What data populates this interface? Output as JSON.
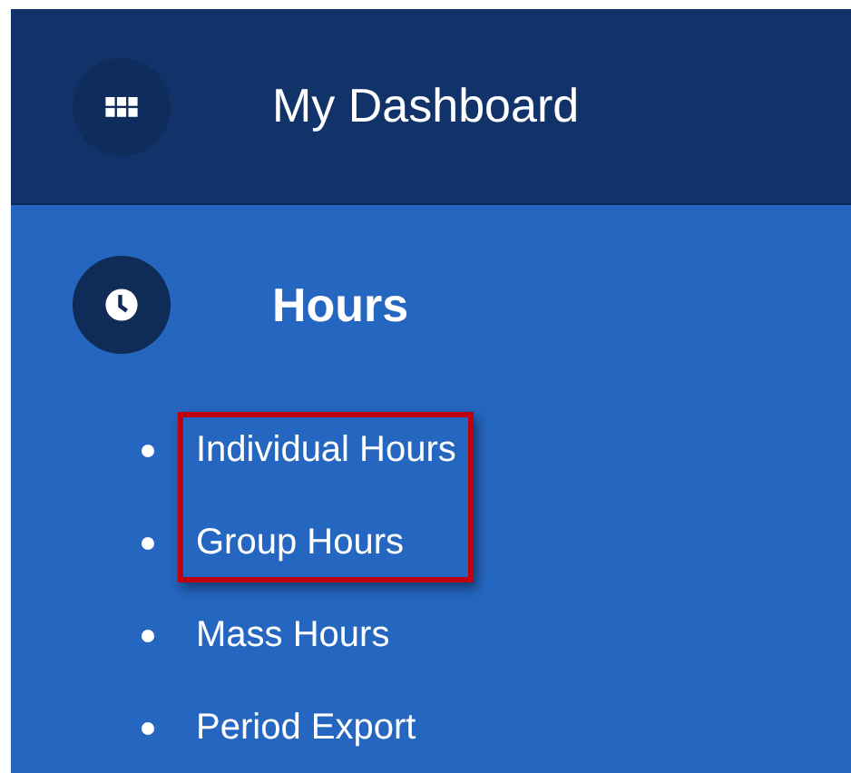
{
  "menu": [
    {
      "label": "My Dashboard",
      "kind": "grid",
      "selected": false
    },
    {
      "label": "Hours",
      "kind": "clock",
      "selected": true,
      "children": [
        {
          "label": "Individual Hours",
          "highlighted": true
        },
        {
          "label": "Group Hours",
          "highlighted": true
        },
        {
          "label": "Mass Hours",
          "highlighted": false
        },
        {
          "label": "Period Export",
          "highlighted": false
        }
      ]
    }
  ]
}
